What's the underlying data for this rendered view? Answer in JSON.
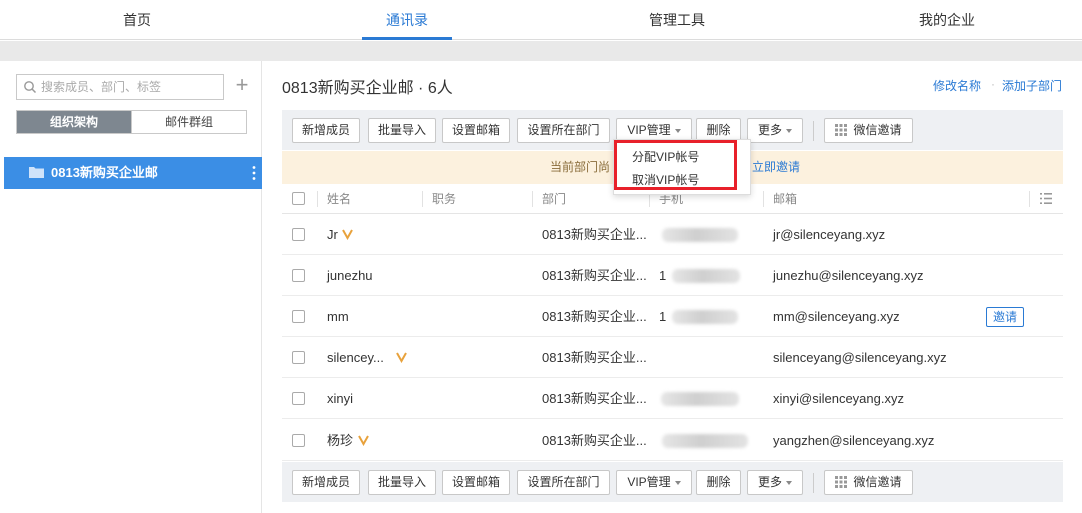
{
  "nav": {
    "items": [
      {
        "label": "首页"
      },
      {
        "label": "通讯录",
        "active": true
      },
      {
        "label": "管理工具"
      },
      {
        "label": "我的企业"
      }
    ]
  },
  "sidebar": {
    "search_placeholder": "搜索成员、部门、标签",
    "add_icon": "plus-icon",
    "tabs": [
      "组织架构",
      "邮件群组"
    ],
    "active_tab": "组织架构",
    "tree": [
      {
        "label": "0813新购买企业邮",
        "selected": true,
        "icon": "folder-icon"
      }
    ]
  },
  "header": {
    "title": "0813新购买企业邮 · 6人",
    "rename_link": "修改名称",
    "separator": "·",
    "add_subdept_link": "添加子部门"
  },
  "toolbar": {
    "add_member": "新增成员",
    "batch_import": "批量导入",
    "set_mailbox": "设置邮箱",
    "set_dept": "设置所在部门",
    "vip": "VIP管理",
    "delete": "删除",
    "more": "更多",
    "wechat_invite": "微信邀请"
  },
  "vip_menu": {
    "items": [
      "分配VIP帐号",
      "取消VIP帐号"
    ]
  },
  "notice": {
    "text": "当前部门尚",
    "link": "立即邀请"
  },
  "table": {
    "columns": [
      "姓名",
      "职务",
      "部门",
      "手机",
      "邮箱"
    ],
    "rows": [
      {
        "name": "Jr",
        "vip": true,
        "title": "",
        "dept": "0813新购买企业...",
        "mobile_hidden": true,
        "mobile_visible": "",
        "email": "jr@silenceyang.xyz",
        "invite": ""
      },
      {
        "name": "junezhu",
        "vip": false,
        "title": "",
        "dept": "0813新购买企业...",
        "mobile_hidden": true,
        "mobile_visible": "1",
        "email": "junezhu@silenceyang.xyz",
        "invite": ""
      },
      {
        "name": "mm",
        "vip": false,
        "title": "",
        "dept": "0813新购买企业...",
        "mobile_hidden": true,
        "mobile_visible": "1",
        "email": "mm@silenceyang.xyz",
        "invite": "邀请"
      },
      {
        "name": "silencey...",
        "vip": true,
        "title": "",
        "dept": "0813新购买企业...",
        "mobile_hidden": false,
        "mobile_visible": "",
        "email": "silenceyang@silenceyang.xyz",
        "invite": ""
      },
      {
        "name": "xinyi",
        "vip": false,
        "title": "",
        "dept": "0813新购买企业...",
        "mobile_hidden": true,
        "mobile_visible": "",
        "email": "xinyi@silenceyang.xyz",
        "invite": ""
      },
      {
        "name": "杨珍",
        "vip": true,
        "title": "",
        "dept": "0813新购买企业...",
        "mobile_hidden": true,
        "mobile_visible": "",
        "email": "yangzhen@silenceyang.xyz",
        "invite": ""
      }
    ]
  },
  "colors": {
    "accent": "#2a7ad4",
    "selected_bg": "#3b8ee5",
    "highlight_box": "#e8202a",
    "vip_mark": "#e8a23c",
    "notice_bg": "#fcf1de"
  }
}
